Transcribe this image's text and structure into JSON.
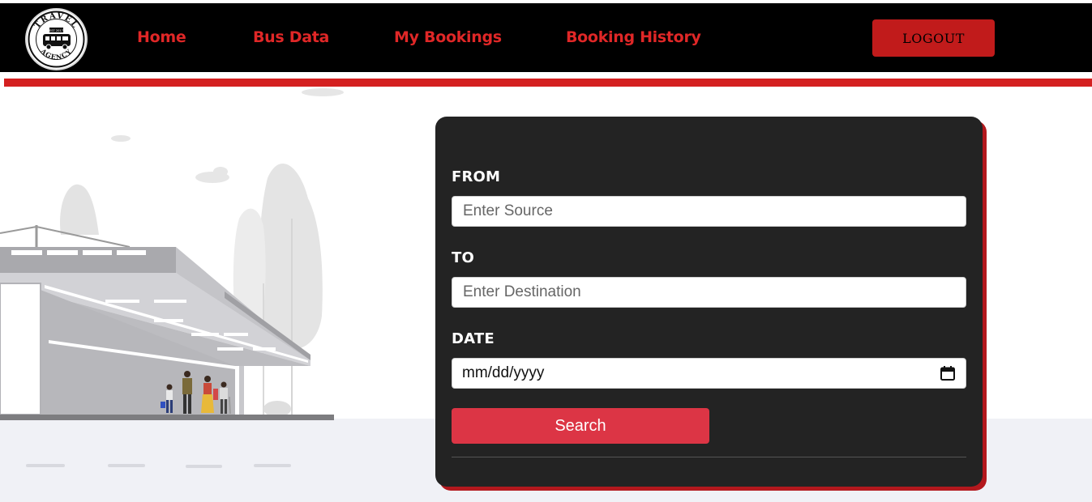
{
  "navbar": {
    "logo": {
      "icon": "travel-agency-logo",
      "text_top": "TRAVEL",
      "text_bottom": "AGENCY",
      "badge": "EST 2017"
    },
    "links": [
      {
        "label": "Home"
      },
      {
        "label": "Bus Data"
      },
      {
        "label": "My Bookings"
      },
      {
        "label": "Booking History"
      }
    ],
    "logout_label": "LOGOUT"
  },
  "form": {
    "from_label": "FROM",
    "from_placeholder": "Enter Source",
    "from_value": "",
    "to_label": "TO",
    "to_placeholder": "Enter Destination",
    "to_value": "",
    "date_label": "DATE",
    "date_placeholder": "mm/dd/yyyy",
    "search_label": "Search"
  },
  "colors": {
    "nav_bg": "#000000",
    "nav_link": "#e02727",
    "accent_red": "#d42020",
    "card_bg": "#232323",
    "search_button": "#dc3545",
    "floor": "#f0f1f6"
  }
}
